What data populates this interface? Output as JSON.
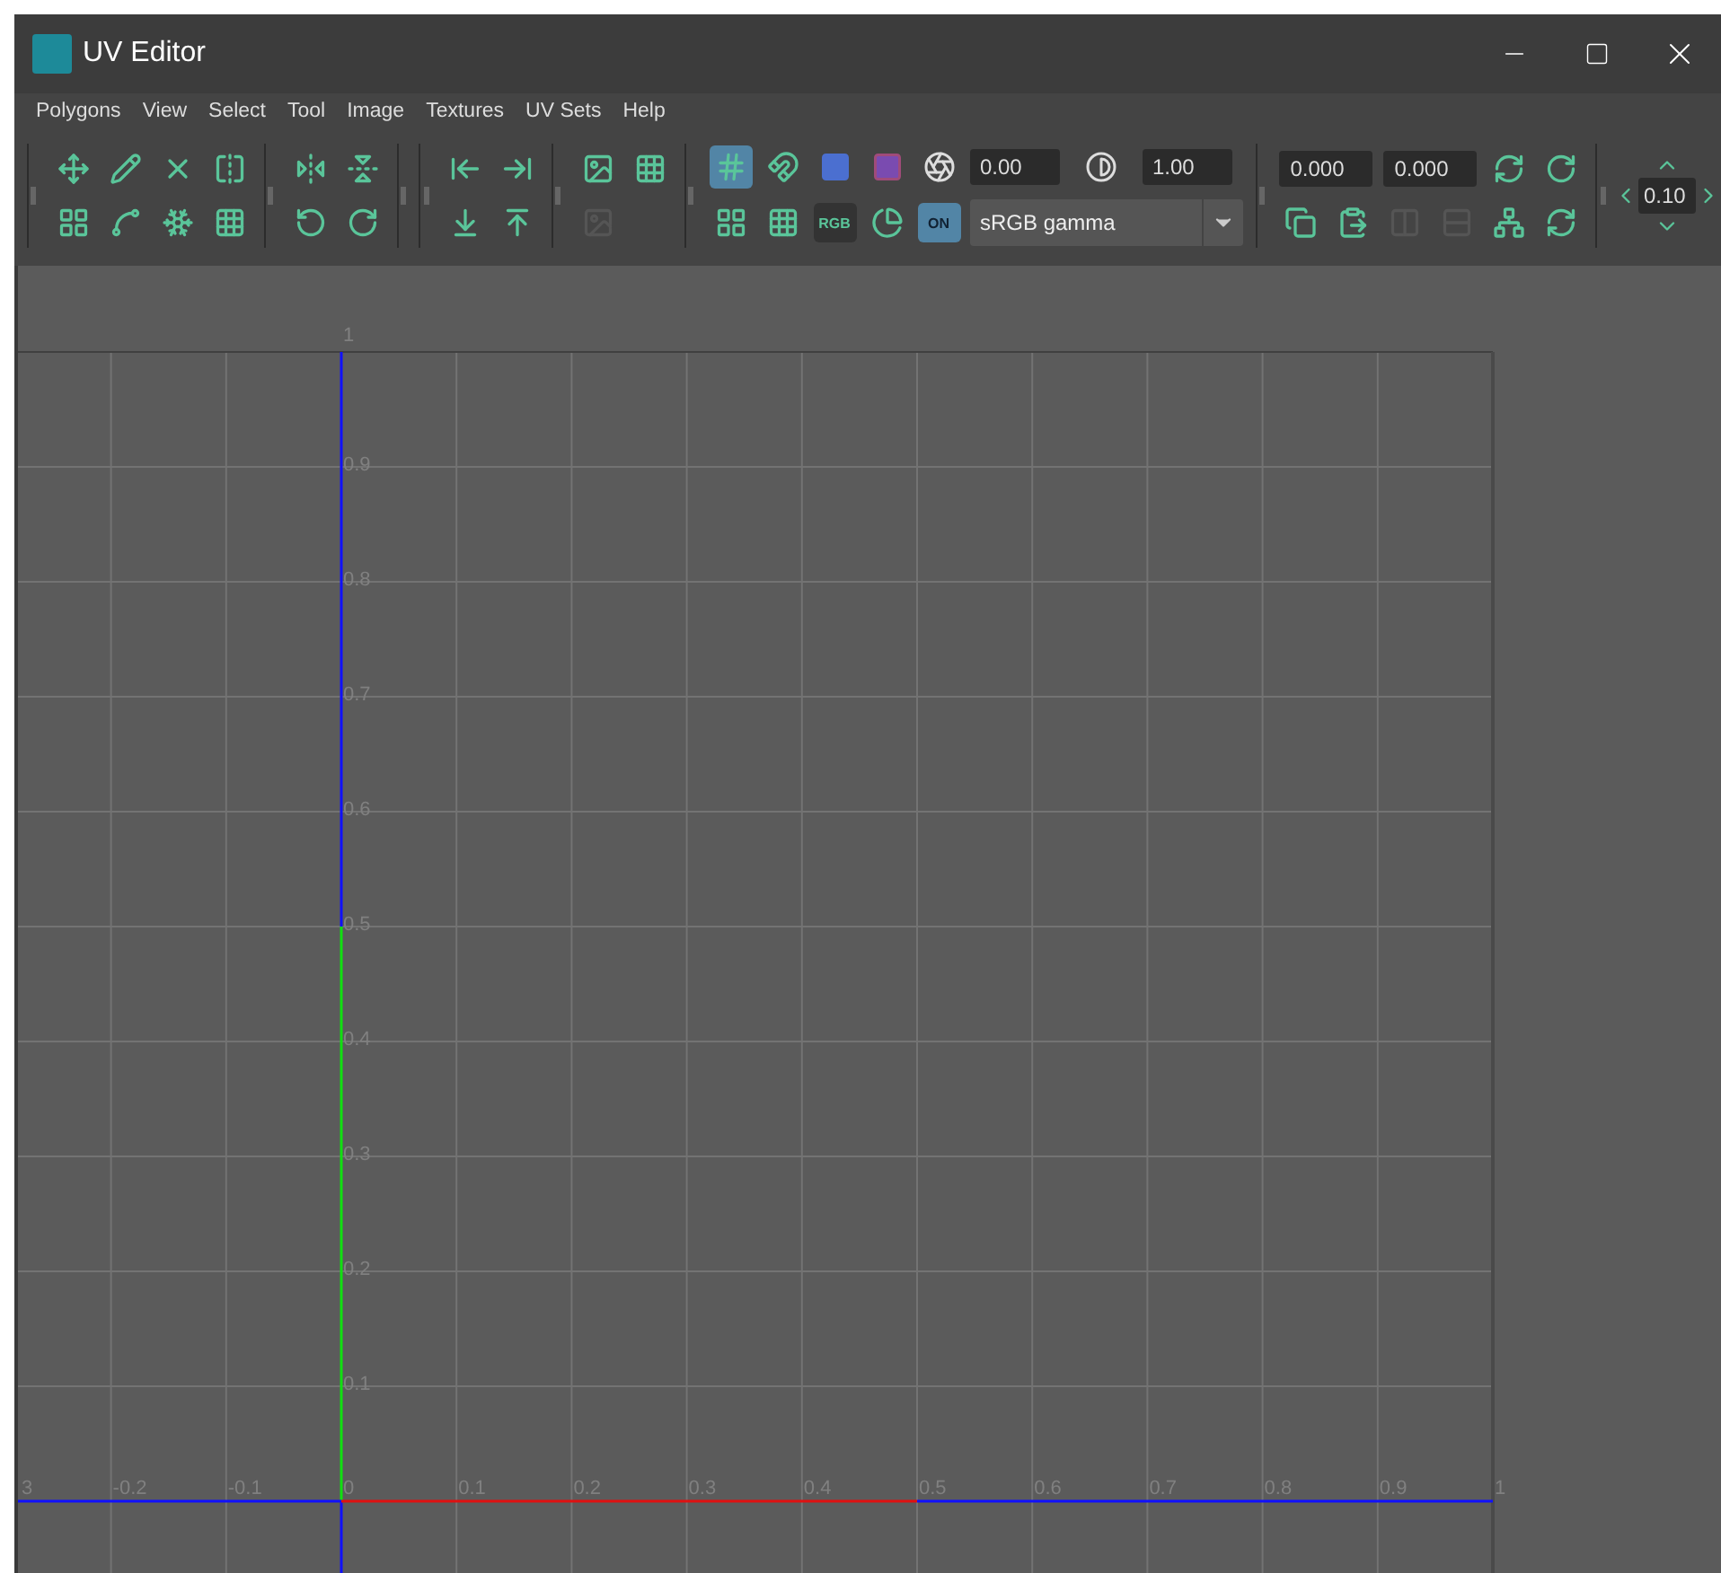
{
  "window": {
    "title": "UV Editor"
  },
  "menu": [
    "Polygons",
    "View",
    "Select",
    "Tool",
    "Image",
    "Textures",
    "UV Sets",
    "Help"
  ],
  "toolbar": {
    "grid_toggle": {
      "selected": true
    },
    "exposure": "0.00",
    "gamma": "1.00",
    "channel": {
      "label": "RGB"
    },
    "color_management": {
      "label": "ON",
      "on": true
    },
    "view_transform": "sRGB gamma",
    "u_field": "0.000",
    "v_field": "0.000",
    "step": "0.10"
  },
  "uv_grid": {
    "u_labels": [
      "3",
      "-0.2",
      "-0.1",
      "0",
      "0.1",
      "0.2",
      "0.3",
      "0.4",
      "0.5",
      "0.6",
      "0.7",
      "0.8",
      "0.9",
      "1"
    ],
    "v_labels": [
      "1",
      "0.9",
      "0.8",
      "0.7",
      "0.6",
      "0.5",
      "0.4",
      "0.3",
      "0.2",
      "0.1"
    ]
  }
}
